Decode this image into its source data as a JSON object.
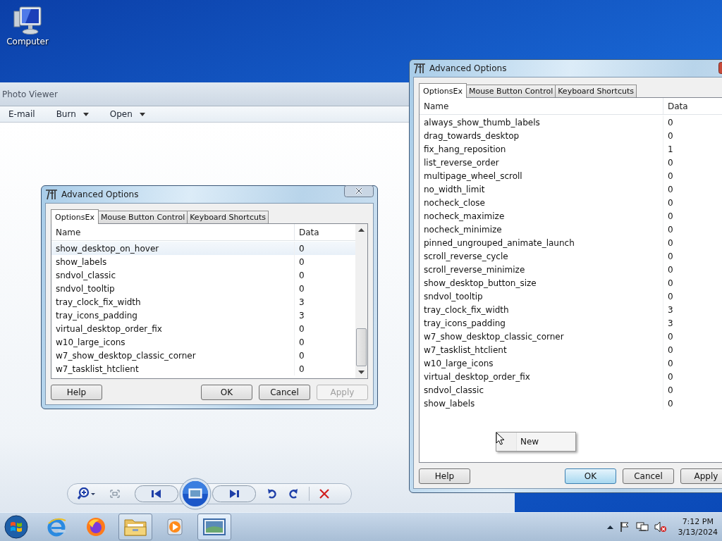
{
  "desktop_icons": [
    {
      "label": "Computer"
    }
  ],
  "photo_viewer": {
    "title": "Photo Viewer",
    "toolbar": [
      {
        "label": "E-mail",
        "dropdown": false
      },
      {
        "label": "Burn",
        "dropdown": true
      },
      {
        "label": "Open",
        "dropdown": true
      }
    ]
  },
  "dialogs": [
    {
      "title": "Advanced Options",
      "scrollbar": true,
      "tabs": [
        {
          "label": "OptionsEx",
          "selected": true
        },
        {
          "label": "Mouse Button Control",
          "selected": false
        },
        {
          "label": "Keyboard Shortcuts",
          "selected": false
        }
      ],
      "columns": [
        "Name",
        "Data"
      ],
      "rows": [
        {
          "name": "show_desktop_on_hover",
          "data": "0",
          "selected": true
        },
        {
          "name": "show_labels",
          "data": "0",
          "selected": false
        },
        {
          "name": "sndvol_classic",
          "data": "0",
          "selected": false
        },
        {
          "name": "sndvol_tooltip",
          "data": "0",
          "selected": false
        },
        {
          "name": "tray_clock_fix_width",
          "data": "3",
          "selected": false
        },
        {
          "name": "tray_icons_padding",
          "data": "3",
          "selected": false
        },
        {
          "name": "virtual_desktop_order_fix",
          "data": "0",
          "selected": false
        },
        {
          "name": "w10_large_icons",
          "data": "0",
          "selected": false
        },
        {
          "name": "w7_show_desktop_classic_corner",
          "data": "0",
          "selected": false
        },
        {
          "name": "w7_tasklist_htclient",
          "data": "0",
          "selected": false
        }
      ],
      "buttons": [
        {
          "label": "Help",
          "disabled": false,
          "default": false
        },
        {
          "label": "OK",
          "disabled": false,
          "default": false
        },
        {
          "label": "Cancel",
          "disabled": false,
          "default": false
        },
        {
          "label": "Apply",
          "disabled": true,
          "default": false
        }
      ]
    },
    {
      "title": "Advanced Options",
      "scrollbar": false,
      "tabs": [
        {
          "label": "OptionsEx",
          "selected": true
        },
        {
          "label": "Mouse Button Control",
          "selected": false
        },
        {
          "label": "Keyboard Shortcuts",
          "selected": false
        }
      ],
      "columns": [
        "Name",
        "Data"
      ],
      "rows": [
        {
          "name": "always_show_thumb_labels",
          "data": "0",
          "selected": false
        },
        {
          "name": "drag_towards_desktop",
          "data": "0",
          "selected": false
        },
        {
          "name": "fix_hang_reposition",
          "data": "1",
          "selected": false
        },
        {
          "name": "list_reverse_order",
          "data": "0",
          "selected": false
        },
        {
          "name": "multipage_wheel_scroll",
          "data": "0",
          "selected": false
        },
        {
          "name": "no_width_limit",
          "data": "0",
          "selected": false
        },
        {
          "name": "nocheck_close",
          "data": "0",
          "selected": false
        },
        {
          "name": "nocheck_maximize",
          "data": "0",
          "selected": false
        },
        {
          "name": "nocheck_minimize",
          "data": "0",
          "selected": false
        },
        {
          "name": "pinned_ungrouped_animate_launch",
          "data": "0",
          "selected": false
        },
        {
          "name": "scroll_reverse_cycle",
          "data": "0",
          "selected": false
        },
        {
          "name": "scroll_reverse_minimize",
          "data": "0",
          "selected": false
        },
        {
          "name": "show_desktop_button_size",
          "data": "0",
          "selected": false
        },
        {
          "name": "sndvol_tooltip",
          "data": "0",
          "selected": false
        },
        {
          "name": "tray_clock_fix_width",
          "data": "3",
          "selected": false
        },
        {
          "name": "tray_icons_padding",
          "data": "3",
          "selected": false
        },
        {
          "name": "w7_show_desktop_classic_corner",
          "data": "0",
          "selected": false
        },
        {
          "name": "w7_tasklist_htclient",
          "data": "0",
          "selected": false
        },
        {
          "name": "w10_large_icons",
          "data": "0",
          "selected": false
        },
        {
          "name": "virtual_desktop_order_fix",
          "data": "0",
          "selected": false
        },
        {
          "name": "sndvol_classic",
          "data": "0",
          "selected": false
        },
        {
          "name": "show_labels",
          "data": "0",
          "selected": false
        }
      ],
      "buttons": [
        {
          "label": "Help",
          "disabled": false,
          "default": false
        },
        {
          "label": "OK",
          "disabled": false,
          "default": true
        },
        {
          "label": "Cancel",
          "disabled": false,
          "default": false
        },
        {
          "label": "Apply",
          "disabled": false,
          "default": false
        }
      ]
    }
  ],
  "context_menu": {
    "items": [
      {
        "label": "New"
      }
    ]
  },
  "taskbar": {
    "time": "7:12 PM",
    "date": "3/13/2024"
  }
}
